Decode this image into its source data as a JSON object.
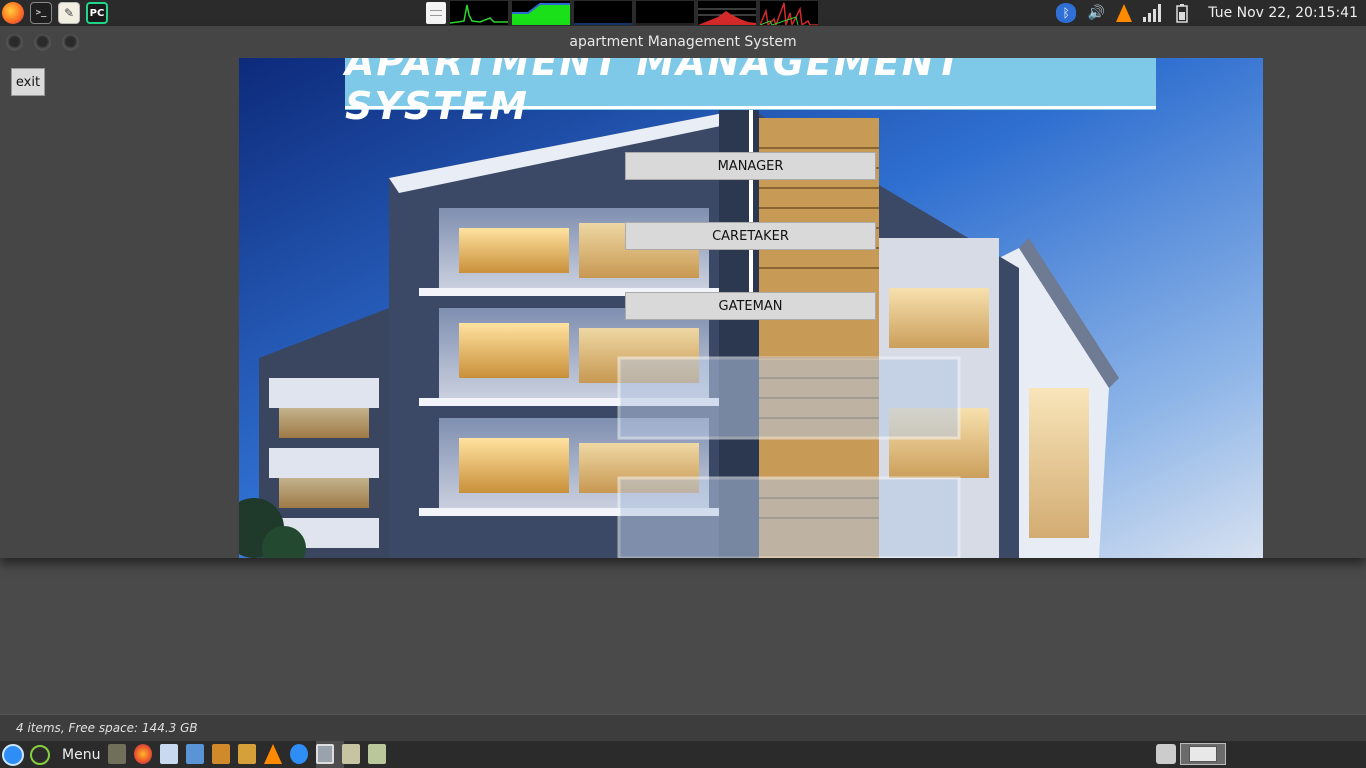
{
  "top_panel": {
    "launchers": [
      "firefox-icon",
      "terminal-icon",
      "text-editor-icon",
      "pycharm-icon"
    ],
    "pycharm_label": "PC",
    "tray_icons": [
      "bluetooth-icon",
      "volume-icon",
      "vlc-icon",
      "network-signal-icon",
      "battery-icon"
    ],
    "clock": "Tue Nov 22, 20:15:41"
  },
  "window": {
    "title": "apartment Management System",
    "exit_label": "exit",
    "banner_title": "APARTMENT MANAGEMENT SYSTEM",
    "buttons": {
      "manager": "MANAGER",
      "caretaker": "CARETAKER",
      "gateman": "GATEMAN"
    }
  },
  "file_manager": {
    "status": "4 items, Free space: 144.3 GB"
  },
  "bottom_panel": {
    "menu_label": "Menu"
  },
  "colors": {
    "banner": "#7ec8e8",
    "panel": "#2b2b2b",
    "window_bg": "#464646",
    "button": "#d9d9d9"
  }
}
